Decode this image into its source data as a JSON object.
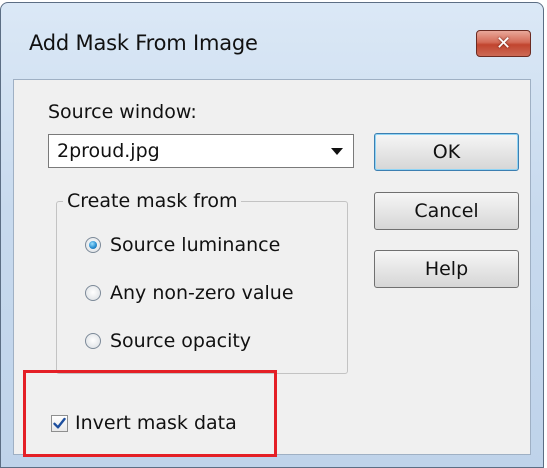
{
  "dialog": {
    "title": "Add Mask From Image",
    "close_symbol": "✕"
  },
  "source_window": {
    "label": "Source window:",
    "value": "2proud.jpg"
  },
  "group": {
    "label": "Create mask from",
    "options": [
      {
        "label": "Source luminance",
        "checked": true
      },
      {
        "label": "Any non-zero value",
        "checked": false
      },
      {
        "label": "Source opacity",
        "checked": false
      }
    ]
  },
  "invert": {
    "label": "Invert mask data",
    "checked": true
  },
  "buttons": {
    "ok": "OK",
    "cancel": "Cancel",
    "help": "Help"
  },
  "colors": {
    "highlight": "#e41f26",
    "close_button": "#c1452f",
    "radio_selected": "#2a8fd1",
    "check_mark": "#1e4f9e"
  },
  "icons": {
    "close": "close-icon",
    "dropdown": "chevron-down-icon",
    "checkmark": "checkmark-icon"
  }
}
